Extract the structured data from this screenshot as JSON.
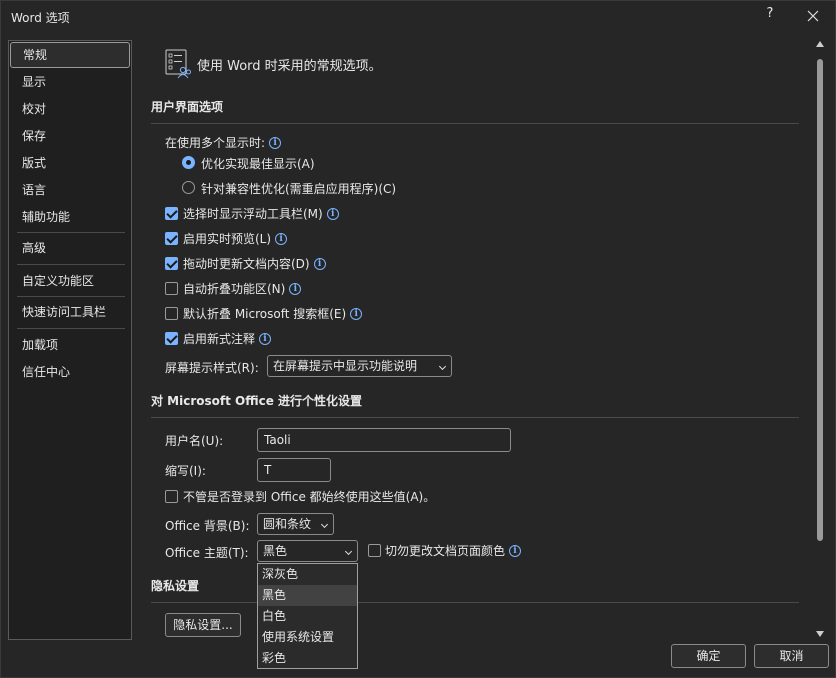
{
  "window": {
    "title": "Word 选项",
    "help": "?"
  },
  "sidebar": {
    "items": [
      {
        "label": "常规"
      },
      {
        "label": "显示"
      },
      {
        "label": "校对"
      },
      {
        "label": "保存"
      },
      {
        "label": "版式"
      },
      {
        "label": "语言"
      },
      {
        "label": "辅助功能"
      },
      {
        "label": "高级"
      },
      {
        "label": "自定义功能区"
      },
      {
        "label": "快速访问工具栏"
      },
      {
        "label": "加载项"
      },
      {
        "label": "信任中心"
      }
    ],
    "selected": "常规"
  },
  "header": {
    "text": "使用 Word 时采用的常规选项。"
  },
  "ui_options": {
    "title": "用户界面选项",
    "multi_display_label": "在使用多个显示时:",
    "radio_best": "优化实现最佳显示(A)",
    "radio_compat": "针对兼容性优化(需重启应用程序)(C)",
    "mini_toolbar": "选择时显示浮动工具栏(M)",
    "live_preview": "启用实时预览(L)",
    "update_drag": "拖动时更新文档内容(D)",
    "collapse_ribbon": "自动折叠功能区(N)",
    "collapse_search": "默认折叠 Microsoft 搜索框(E)",
    "modern_comments": "启用新式注释",
    "screentip_label": "屏幕提示样式(R):",
    "screentip_value": "在屏幕提示中显示功能说明"
  },
  "personalize": {
    "title": "对 Microsoft Office 进行个性化设置",
    "username_label": "用户名(U):",
    "username_value": "Taoli",
    "initials_label": "缩写(I):",
    "initials_value": "T",
    "always_use": "不管是否登录到 Office 都始终使用这些值(A)。",
    "background_label": "Office 背景(B):",
    "background_value": "圆和条纹",
    "theme_label": "Office 主题(T):",
    "theme_value": "黑色",
    "never_change": "切勿更改文档页面颜色",
    "theme_options": [
      "深灰色",
      "黑色",
      "白色",
      "使用系统设置",
      "彩色"
    ],
    "theme_highlighted": "黑色"
  },
  "privacy": {
    "title": "隐私设置",
    "button": "隐私设置..."
  },
  "footer": {
    "ok": "确定",
    "cancel": "取消"
  },
  "colors": {
    "accent": "#7ab3ff",
    "background": "#262626"
  }
}
